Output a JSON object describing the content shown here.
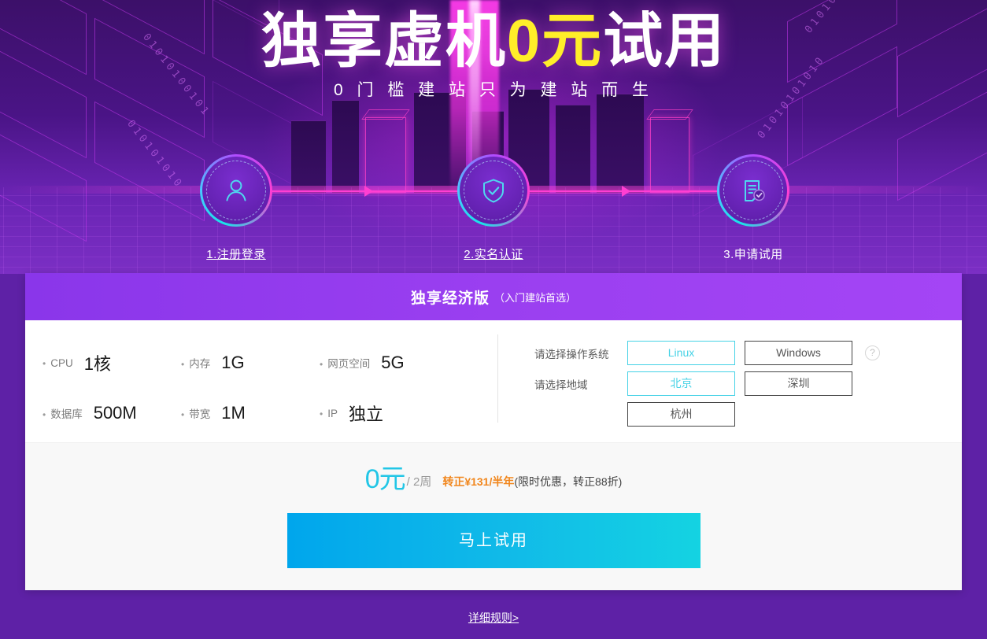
{
  "hero": {
    "title_pre": "独享虚机",
    "title_highlight": "0元",
    "title_post": "试用",
    "subtitle": "0 门 槛 建 站   只 为 建 站 而 生",
    "highlight_color": "#ffee29"
  },
  "steps": [
    {
      "label": "1.注册登录",
      "icon": "user-icon",
      "is_link": true
    },
    {
      "label": "2.实名认证",
      "icon": "shield-check-icon",
      "is_link": true
    },
    {
      "label": "3.申请试用",
      "icon": "document-check-icon",
      "is_link": false
    }
  ],
  "card": {
    "header": {
      "name": "独享经济版",
      "note": "（入门建站首选）",
      "bg_color": "#9a3ff0"
    },
    "specs": [
      {
        "key": "CPU",
        "value": "1核"
      },
      {
        "key": "内存",
        "value": "1G"
      },
      {
        "key": "网页空间",
        "value": "5G"
      },
      {
        "key": "数据库",
        "value": "500M"
      },
      {
        "key": "带宽",
        "value": "1M"
      },
      {
        "key": "IP",
        "value": "独立"
      }
    ],
    "options": {
      "os": {
        "label": "请选择操作系统",
        "choices": [
          "Linux",
          "Windows"
        ],
        "selected": "Linux",
        "help_icon": "?"
      },
      "region": {
        "label": "请选择地域",
        "choices": [
          "北京",
          "深圳",
          "杭州"
        ],
        "selected": "北京"
      },
      "selected_color": "#45d2e6"
    },
    "price": {
      "amount": "0元",
      "period": "/ 2周",
      "renew": "转正¥131/半年",
      "note": "(限时优惠，转正88折)",
      "amount_color": "#22c6e6",
      "renew_color": "#f1861c"
    },
    "cta_label": "马上试用"
  },
  "footer": {
    "rules_link": "详细规则>"
  }
}
